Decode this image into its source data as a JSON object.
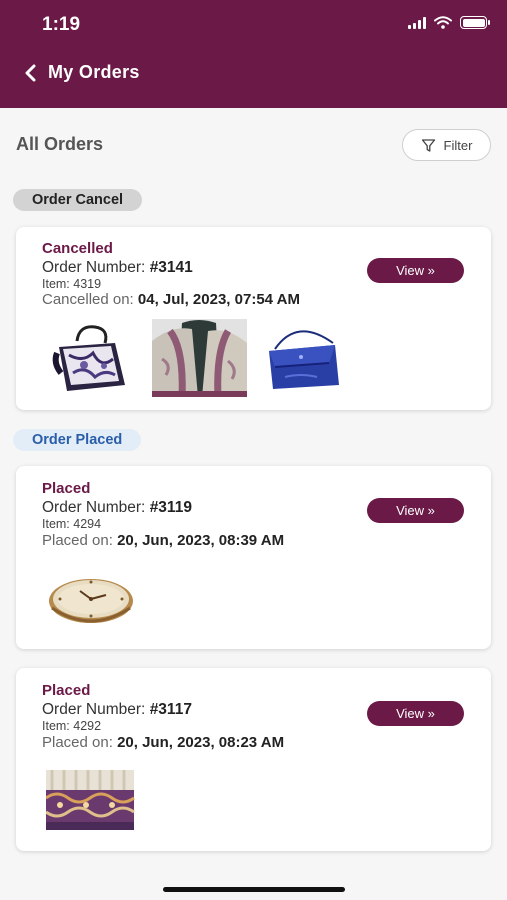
{
  "status_bar": {
    "time": "1:19"
  },
  "nav": {
    "title": "My Orders"
  },
  "subheader": {
    "title": "All Orders",
    "filter_label": "Filter"
  },
  "sections": {
    "cancel": {
      "label": "Order Cancel"
    },
    "placed": {
      "label": "Order Placed"
    }
  },
  "orders": [
    {
      "status": "Cancelled",
      "number_label": "Order Number:",
      "number": "#3141",
      "item_label": "Item:",
      "item": "4319",
      "date_label": "Cancelled on:",
      "date": "04, Jul, 2023, 07:54 AM",
      "view_label": "View »",
      "thumbnails": [
        "bag-image",
        "shawl-image",
        "blue-purse-image"
      ]
    },
    {
      "status": "Placed",
      "number_label": "Order Number:",
      "number": "#3119",
      "item_label": "Item:",
      "item": "4294",
      "date_label": "Placed on:",
      "date": "20, Jun, 2023, 08:39 AM",
      "view_label": "View »",
      "thumbnails": [
        "wall-clock-image"
      ]
    },
    {
      "status": "Placed",
      "number_label": "Order Number:",
      "number": "#3117",
      "item_label": "Item:",
      "item": "4292",
      "date_label": "Placed on:",
      "date": "20, Jun, 2023, 08:23 AM",
      "view_label": "View »",
      "thumbnails": [
        "fabric-image"
      ]
    }
  ],
  "colors": {
    "brand": "#6b1a47",
    "placed_pill_bg": "#e3edf8",
    "placed_pill_text": "#2a5ea8"
  }
}
